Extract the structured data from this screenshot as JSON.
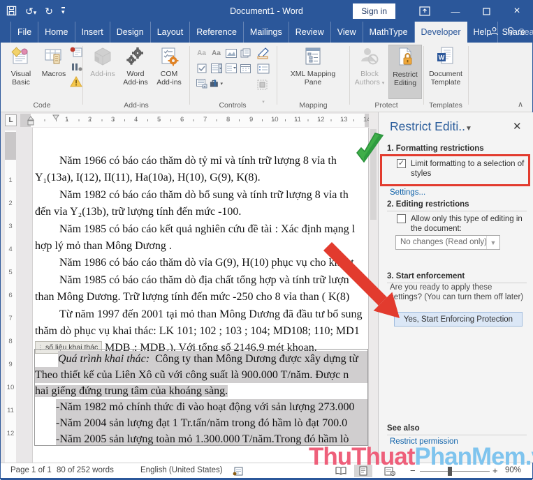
{
  "window": {
    "title": "Document1 - Word",
    "sign_in": "Sign in"
  },
  "tabs": {
    "items": [
      "File",
      "Home",
      "Insert",
      "Design",
      "Layout",
      "Reference",
      "Mailings",
      "Review",
      "View",
      "MathType",
      "Developer",
      "Help"
    ],
    "active": "Developer",
    "search": "Search",
    "share": "Share"
  },
  "ribbon": {
    "buttons": {
      "visual_basic": "Visual Basic",
      "macros": "Macros",
      "add_ins": "Add-ins",
      "word_add_ins": "Word Add-ins",
      "com_add_ins": "COM Add-ins",
      "xml_mapping": "XML Mapping Pane",
      "block_authors": "Block Authors",
      "restrict_editing": "Restrict Editing",
      "document_template": "Document Template"
    },
    "groups": {
      "code": "Code",
      "add_ins": "Add-ins",
      "controls": "Controls",
      "mapping": "Mapping",
      "protect": "Protect",
      "templates": "Templates"
    }
  },
  "ruler": {
    "h": [
      "1",
      "2",
      "3",
      "4",
      "5",
      "6",
      "7",
      "8",
      "9",
      "10",
      "11",
      "12",
      "13",
      "14"
    ],
    "v": [
      "1",
      "2",
      "3",
      "4",
      "5",
      "6",
      "7",
      "8",
      "9",
      "10",
      "11",
      "12"
    ]
  },
  "document": {
    "content_control_tag": "số liệu khai thác",
    "lines": [
      {
        "text": "Năm 1966 có báo cáo thăm dò tỷ mỉ và tính trữ lượng 8 vỉa th"
      },
      {
        "text": "Y₁(13a), I(12), II(11), Ha(10a), H(10), G(9), K(8)."
      },
      {
        "text": "Năm 1982 có báo cáo thăm dò bổ sung và tính trữ lượng 8 vỉa th"
      },
      {
        "text": "đến vỉa Y₂(13b), trữ lượng tính đến mức -100."
      },
      {
        "text": "Năm 1985 có báo cáo kết quả nghiên cứu đề tài : Xác định mạng l"
      },
      {
        "text": "hợp lý mỏ than Mông Dương ."
      },
      {
        "text": "Năm 1986 có báo cáo thăm dò vỉa G(9), H(10) phục vụ cho khai t"
      },
      {
        "text": "Năm 1985 có báo cáo thăm dò địa chất tổng hợp và tính trữ  lượn"
      },
      {
        "text": "than Mông Dương. Trữ lượng tính đến mức -250 cho 8 vỉa than ( K(8)"
      },
      {
        "text": "Từ năm 1997 đến 2001 tại mỏ than Mông Dương đã đầu tư bổ sung"
      },
      {
        "text": "thăm dò phục vụ khai thác: LK 101; 102 ; 103 ; 104; MD108; 110; MD1"
      },
      {
        "text": "MDB₂; MDB₃). Với tổng số 2146,9 mét khoan."
      },
      {
        "italic": "Quá trình khai thác:",
        "text": " Công ty than Mông Dương được xây dựng từ"
      },
      {
        "text": "Theo thiết kế của Liên Xô cũ với công suất là 900.000 T/năm. Được n"
      },
      {
        "text": "hai giếng đứng trung tâm của khoáng sàng."
      },
      {
        "text": "-Năm 1982 mỏ chính thức đi vào hoạt động với sản lượng 273.000"
      },
      {
        "text": "-Năm 2004 sản lượng đạt 1 Tr.tấn/năm trong đó hầm lò đạt  700.0"
      },
      {
        "text": "-Năm 2005 sản lượng toàn mỏ 1.300.000 T/năm.Trong đó hầm lò"
      }
    ]
  },
  "pane": {
    "title": "Restrict Editi..",
    "formatting": {
      "heading": "1. Formatting restrictions",
      "checkbox_label": "Limit formatting to a selection of styles",
      "checkbox_checked": "✓",
      "settings_link": "Settings..."
    },
    "editing": {
      "heading": "2. Editing restrictions",
      "checkbox_label": "Allow only this type of editing in the document:",
      "dropdown_value": "No changes (Read only)"
    },
    "enforcement": {
      "heading": "3. Start enforcement",
      "description": "Are you ready to apply these settings? (You can turn them off later)",
      "button_label": "Yes, Start Enforcing Protection"
    },
    "see_also": {
      "heading": "See also",
      "link": "Restrict permission"
    }
  },
  "status_bar": {
    "page": "Page 1 of 1",
    "words": "80 of 252 words",
    "language": "English (United States)",
    "zoom": "90%"
  },
  "watermark": {
    "part1": "ThuThuat",
    "part2": "PhanMem",
    "part3": ".vn"
  },
  "colors": {
    "accent_blue": "#2b579a",
    "annotation_red": "#e23b2e",
    "annotation_green": "#3fae49",
    "selection_gray": "#d0cecf",
    "link_blue": "#0e61a9",
    "watermark_pink": "#ee5f7a",
    "watermark_blue": "#7fc4ee"
  }
}
